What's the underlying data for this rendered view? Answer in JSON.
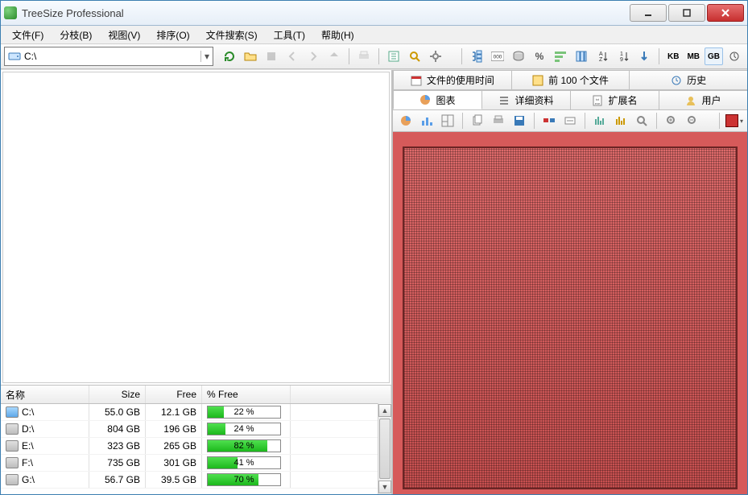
{
  "window": {
    "title": "TreeSize Professional"
  },
  "menubar": [
    {
      "label": "文件(F)"
    },
    {
      "label": "分枝(B)"
    },
    {
      "label": "视图(V)"
    },
    {
      "label": "排序(O)"
    },
    {
      "label": "文件搜索(S)"
    },
    {
      "label": "工具(T)"
    },
    {
      "label": "帮助(H)"
    }
  ],
  "drive_combo": {
    "value": "C:\\"
  },
  "unit_buttons": {
    "kb": "KB",
    "mb": "MB",
    "gb": "GB"
  },
  "drive_table": {
    "headers": {
      "name": "名称",
      "size": "Size",
      "free": "Free",
      "pfree": "% Free"
    },
    "rows": [
      {
        "name": "C:\\",
        "size": "55.0 GB",
        "free": "12.1 GB",
        "pfree_pct": 22,
        "pfree_label": "22 %",
        "system": true
      },
      {
        "name": "D:\\",
        "size": "804 GB",
        "free": "196 GB",
        "pfree_pct": 24,
        "pfree_label": "24 %",
        "system": false
      },
      {
        "name": "E:\\",
        "size": "323 GB",
        "free": "265 GB",
        "pfree_pct": 82,
        "pfree_label": "82 %",
        "system": false
      },
      {
        "name": "F:\\",
        "size": "735 GB",
        "free": "301 GB",
        "pfree_pct": 41,
        "pfree_label": "41 %",
        "system": false
      },
      {
        "name": "G:\\",
        "size": "56.7 GB",
        "free": "39.5 GB",
        "pfree_pct": 70,
        "pfree_label": "70 %",
        "system": false
      }
    ]
  },
  "right_tabs_top": [
    {
      "label": "文件的使用时间"
    },
    {
      "label": "前 100 个文件"
    },
    {
      "label": "历史"
    }
  ],
  "right_tabs_bottom": [
    {
      "label": "图表",
      "active": true
    },
    {
      "label": "详细资料"
    },
    {
      "label": "扩展名"
    },
    {
      "label": "用户"
    }
  ],
  "chart_data": {
    "type": "treemap",
    "title": "",
    "note": "Single root block occupying full area (no subfolder scan yet).",
    "blocks": [
      {
        "label": "",
        "value": 1,
        "color": "#d65a5a"
      }
    ]
  }
}
